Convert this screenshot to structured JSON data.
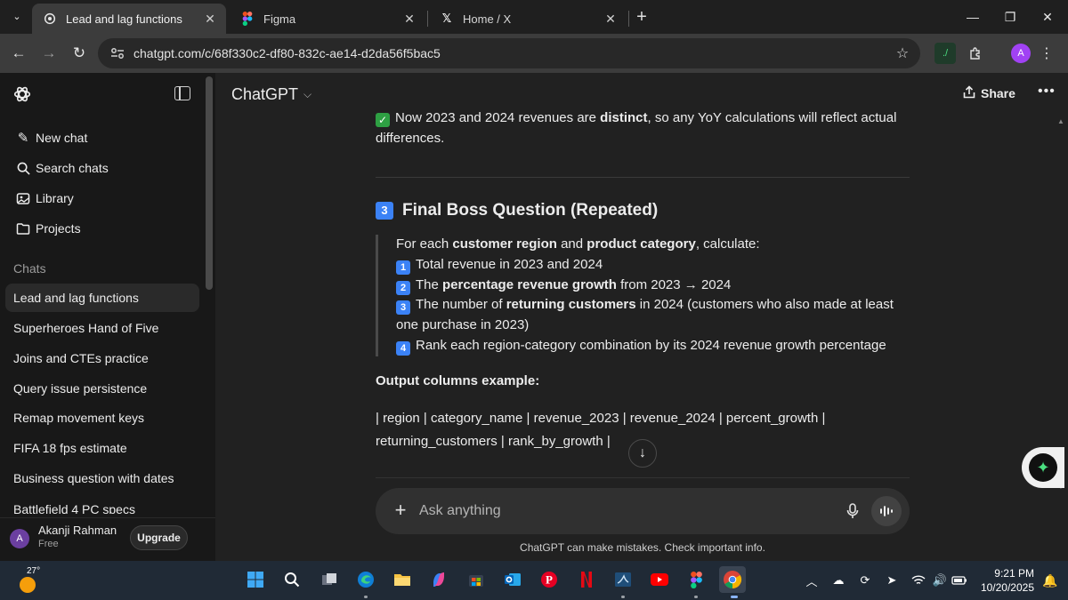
{
  "browser": {
    "tabs": [
      {
        "title": "Lead and lag functions",
        "icon": "chatgpt-icon",
        "active": true
      },
      {
        "title": "Figma",
        "icon": "figma-icon",
        "active": false
      },
      {
        "title": "Home / X",
        "icon": "x-icon",
        "active": false
      }
    ],
    "url": "chatgpt.com/c/68f330c2-df80-832c-ae14-d2da56f5bac5",
    "profile_initial": "A"
  },
  "sidebar": {
    "actions": [
      {
        "label": "New chat",
        "icon": "edit-icon"
      },
      {
        "label": "Search chats",
        "icon": "search-icon"
      },
      {
        "label": "Library",
        "icon": "library-icon"
      },
      {
        "label": "Projects",
        "icon": "folder-icon"
      }
    ],
    "section_title": "Chats",
    "chats": [
      {
        "label": "Lead and lag functions",
        "active": true
      },
      {
        "label": "Superheroes Hand of Five",
        "active": false
      },
      {
        "label": "Joins and CTEs practice",
        "active": false
      },
      {
        "label": "Query issue persistence",
        "active": false
      },
      {
        "label": "Remap movement keys",
        "active": false
      },
      {
        "label": "FIFA 18 fps estimate",
        "active": false
      },
      {
        "label": "Business question with dates",
        "active": false
      },
      {
        "label": "Battlefield 4 PC specs",
        "active": false
      }
    ],
    "user": {
      "initial": "A",
      "name": "Akanji Rahman",
      "plan": "Free",
      "upgrade_label": "Upgrade"
    }
  },
  "header": {
    "title": "ChatGPT",
    "share_label": "Share"
  },
  "message": {
    "para1_pre": "Now 2023 and 2024 revenues are ",
    "para1_bold": "distinct",
    "para1_post": ", so any YoY calculations will reflect actual differences.",
    "heading_num": "3",
    "heading": "Final Boss Question (Repeated)",
    "quote": {
      "line1_pre": "For each ",
      "line1_b1": "customer region",
      "line1_mid": " and ",
      "line1_b2": "product category",
      "line1_post": ", calculate:",
      "items": [
        {
          "num": "1",
          "pre": "Total revenue in 2023 and 2024",
          "bold": "",
          "post": ""
        },
        {
          "num": "2",
          "pre": "The ",
          "bold": "percentage revenue growth",
          "post": " from 2023 → 2024"
        },
        {
          "num": "3",
          "pre": "The number of ",
          "bold": "returning customers",
          "post": " in 2024 (customers who also made at least one purchase in 2023)"
        },
        {
          "num": "4",
          "pre": "Rank each region-category combination by its 2024 revenue growth percentage",
          "bold": "",
          "post": ""
        }
      ]
    },
    "output_label": "Output columns example:",
    "columns_line": "| region | category_name | revenue_2023 | revenue_2024 | percent_growth | returning_customers | rank_by_growth |"
  },
  "composer": {
    "placeholder": "Ask anything"
  },
  "disclaimer": "ChatGPT can make mistakes. Check important info.",
  "taskbar": {
    "temperature": "27°",
    "time": "9:21 PM",
    "date": "10/20/2025"
  }
}
